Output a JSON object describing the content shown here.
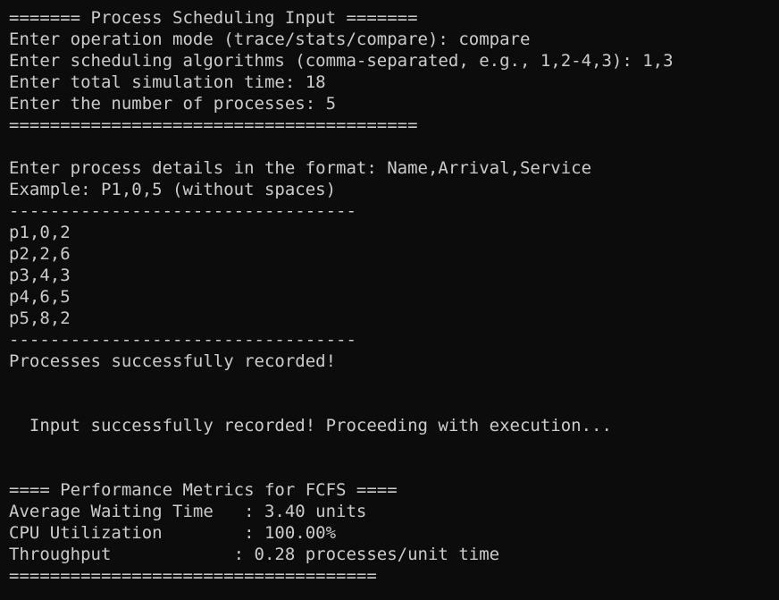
{
  "terminal": {
    "lines": [
      "======= Process Scheduling Input =======",
      "Enter operation mode (trace/stats/compare): compare",
      "Enter scheduling algorithms (comma-separated, e.g., 1,2-4,3): 1,3",
      "Enter total simulation time: 18",
      "Enter the number of processes: 5",
      "========================================",
      "",
      "Enter process details in the format: Name,Arrival,Service",
      "Example: P1,0,5 (without spaces)",
      "----------------------------------",
      "p1,0,2",
      "p2,2,6",
      "p3,4,3",
      "p4,6,5",
      "p5,8,2",
      "----------------------------------",
      "Processes successfully recorded!",
      "",
      "",
      "  Input successfully recorded! Proceeding with execution...",
      "",
      "",
      "==== Performance Metrics for FCFS ====",
      "Average Waiting Time   : 3.40 units",
      "CPU Utilization        : 100.00%",
      "Throughput            : 0.28 processes/unit time",
      "===================================="
    ]
  }
}
